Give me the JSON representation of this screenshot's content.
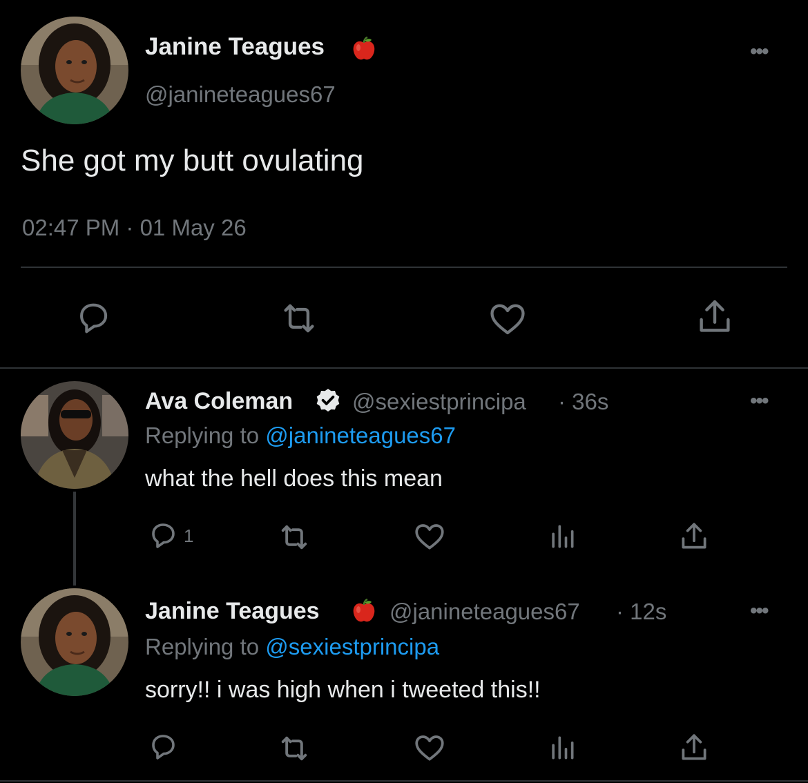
{
  "main_tweet": {
    "name": "Janine Teagues",
    "badge_emoji": "🍎",
    "handle": "@janineteagues67",
    "text": "She got my butt ovulating",
    "timestamp": "02:47 PM · 01 May 26",
    "more": "•••"
  },
  "replies": [
    {
      "name": "Ava Coleman",
      "verified": true,
      "handle": "@sexiestprincipa",
      "time": "· 36s",
      "replying_label": "Replying to",
      "replying_to": "@janineteagues67",
      "text": "what the hell does this mean",
      "reply_count": "1",
      "more": "•••"
    },
    {
      "name": "Janine Teagues",
      "badge_emoji": "🍎",
      "handle": "@janineteagues67",
      "time": "· 12s",
      "replying_label": "Replying to",
      "replying_to": "@sexiestprincipa",
      "text": "sorry!! i was high when i tweeted this!!",
      "reply_count": "",
      "more": "•••"
    }
  ],
  "icons": {
    "reply": "reply-icon",
    "retweet": "retweet-icon",
    "like": "like-icon",
    "share": "share-icon",
    "analytics": "analytics-icon",
    "verified": "verified-badge-icon"
  },
  "colors": {
    "background": "#000000",
    "text": "#e7e9ea",
    "muted": "#71767b",
    "link": "#1d9bf0",
    "apple": "#d9261c"
  }
}
